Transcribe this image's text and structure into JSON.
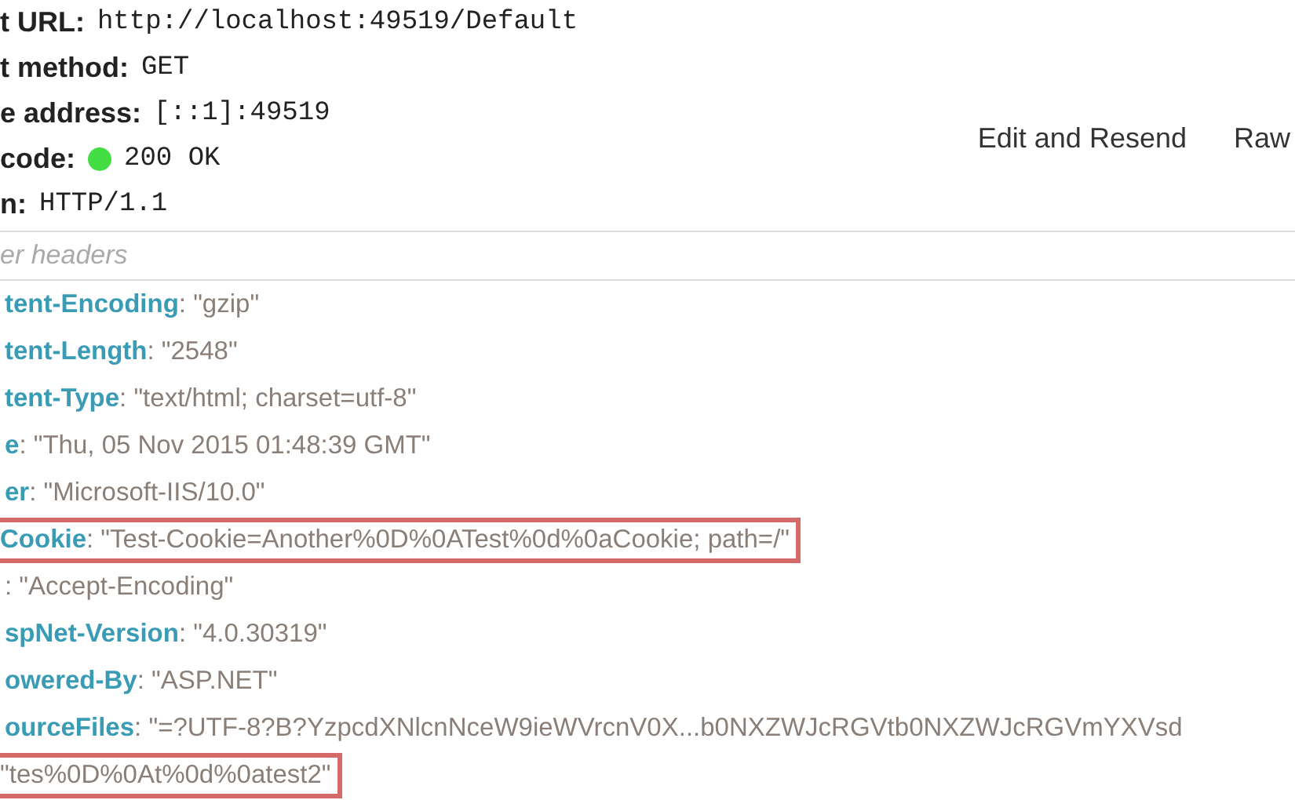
{
  "summary": [
    {
      "label": "t URL:",
      "value": "http://localhost:49519/Default"
    },
    {
      "label": "t method:",
      "value": "GET"
    },
    {
      "label": "e address:",
      "value": "[::1]:49519"
    },
    {
      "label": "code:",
      "value": "200 OK",
      "color": "#44dd44"
    },
    {
      "label": "n:",
      "value": "HTTP/1.1"
    }
  ],
  "actions": [
    "Edit and Resend",
    "Raw"
  ],
  "filter": {
    "placeholder": "er headers"
  },
  "headers": [
    {
      "name": "tent-Encoding",
      "value": ": \"gzip\"",
      "highlighted": false
    },
    {
      "name": "tent-Length",
      "value": ": \"2548\"",
      "highlighted": false
    },
    {
      "name": "tent-Type",
      "value": ": \"text/html; charset=utf-8\"",
      "highlighted": false
    },
    {
      "name": "e",
      "value": ": \"Thu, 05 Nov 2015 01:48:39 GMT\"",
      "highlighted": false
    },
    {
      "name": "er",
      "value": ": \"Microsoft-IIS/10.0\"",
      "highlighted": false
    },
    {
      "name": "Cookie",
      "value": ": \"Test-Cookie=Another%0D%0ATest%0d%0aCookie; path=/\"",
      "highlighted": true
    },
    {
      "value": ": \"Accept-Encoding\"",
      "highlighted": false
    },
    {
      "name": "spNet-Version",
      "value": ": \"4.0.30319\"",
      "highlighted": false
    },
    {
      "name": "owered-By",
      "value": ": \"ASP.NET\"",
      "highlighted": false
    },
    {
      "name": "ourceFiles",
      "value": ": \"=?UTF-8?B?YzpcdXNlcnNceW9ieWVrcnV0X...b0NXZWJcRGVtb0NXZWJcRGVmYXVsd",
      "highlighted": false
    },
    {
      "value": "\"tes%0D%0At%0d%0atest2\"",
      "highlighted": true
    }
  ]
}
